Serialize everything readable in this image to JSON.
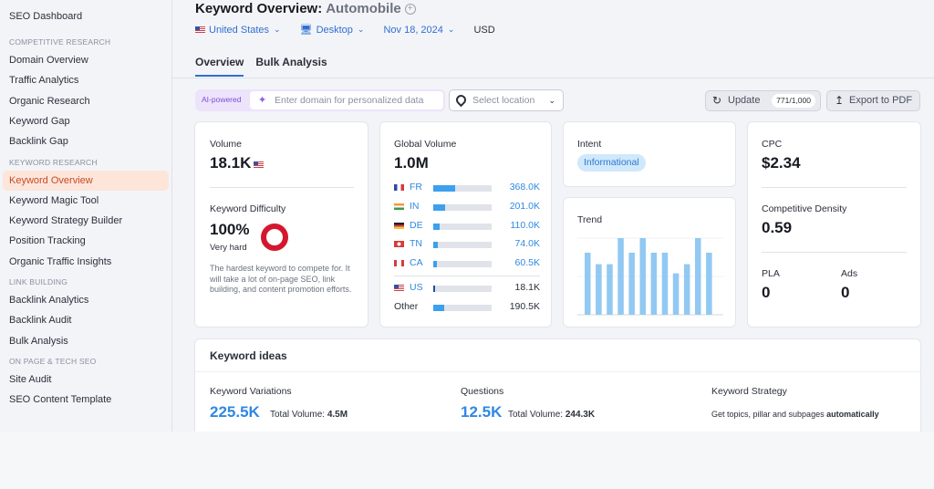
{
  "sidebar": {
    "top_item": "SEO Dashboard",
    "sections": [
      {
        "title": "COMPETITIVE RESEARCH",
        "items": [
          "Domain Overview",
          "Traffic Analytics",
          "Organic Research",
          "Keyword Gap",
          "Backlink Gap"
        ]
      },
      {
        "title": "KEYWORD RESEARCH",
        "items": [
          "Keyword Overview",
          "Keyword Magic Tool",
          "Keyword Strategy Builder",
          "Position Tracking",
          "Organic Traffic Insights"
        ]
      },
      {
        "title": "LINK BUILDING",
        "items": [
          "Backlink Analytics",
          "Backlink Audit",
          "Bulk Analysis"
        ]
      },
      {
        "title": "ON PAGE & TECH SEO",
        "items": [
          "Site Audit",
          "SEO Content Template"
        ]
      }
    ],
    "active_item": "Keyword Overview",
    "active_color": "#c74b25"
  },
  "header": {
    "title": "Keyword Overview:",
    "keyword": "Automobile",
    "add_icon": "plus-circle-icon",
    "filters": {
      "country": "United States",
      "device": "Desktop",
      "date": "Nov 18, 2024",
      "currency": "USD"
    },
    "tabs": [
      "Overview",
      "Bulk Analysis"
    ],
    "active_tab": "Overview"
  },
  "toolbar": {
    "ai_label": "AI-powered",
    "domain_placeholder": "Enter domain for personalized data",
    "location_placeholder": "Select location",
    "update_label": "Update",
    "update_count": "771/1,000",
    "export_label": "Export to PDF"
  },
  "volume_card": {
    "volume_label": "Volume",
    "volume_value": "18.1K",
    "kd_label": "Keyword Difficulty",
    "kd_value": "100%",
    "kd_level": "Very hard",
    "kd_percent": 100,
    "kd_color": "#d4172f",
    "kd_description": "The hardest keyword to compete for. It will take a lot of on-page SEO, link building, and content promotion efforts."
  },
  "global_volume": {
    "label": "Global Volume",
    "value": "1.0M",
    "countries": [
      {
        "code": "FR",
        "value": "368.0K",
        "share": 0.368
      },
      {
        "code": "IN",
        "value": "201.0K",
        "share": 0.201
      },
      {
        "code": "DE",
        "value": "110.0K",
        "share": 0.11
      },
      {
        "code": "TN",
        "value": "74.0K",
        "share": 0.074
      },
      {
        "code": "CA",
        "value": "60.5K",
        "share": 0.0605
      }
    ],
    "us": {
      "code": "US",
      "value": "18.1K",
      "share": 0.0181
    },
    "other": {
      "label": "Other",
      "value": "190.5K",
      "share": 0.1905
    }
  },
  "intent": {
    "label": "Intent",
    "value": "Informational"
  },
  "trend": {
    "label": "Trend",
    "values": [
      0.81,
      0.66,
      0.66,
      1.0,
      0.81,
      1.0,
      0.81,
      0.81,
      0.54,
      0.66,
      1.0,
      0.81
    ],
    "bar_color": "#92c9f2"
  },
  "cpc_card": {
    "cpc_label": "CPC",
    "cpc_value": "$2.34",
    "density_label": "Competitive Density",
    "density_value": "0.59",
    "pla_label": "PLA",
    "pla_value": "0",
    "ads_label": "Ads",
    "ads_value": "0"
  },
  "keyword_ideas": {
    "title": "Keyword ideas",
    "variations_label": "Keyword Variations",
    "variations_value": "225.5K",
    "variations_total_label": "Total Volume:",
    "variations_total": "4.5M",
    "questions_label": "Questions",
    "questions_value": "12.5K",
    "questions_total_label": "Total Volume:",
    "questions_total": "244.3K",
    "strategy_label": "Keyword Strategy",
    "strategy_text": "Get topics, pillar and subpages",
    "strategy_bold": "automatically"
  }
}
